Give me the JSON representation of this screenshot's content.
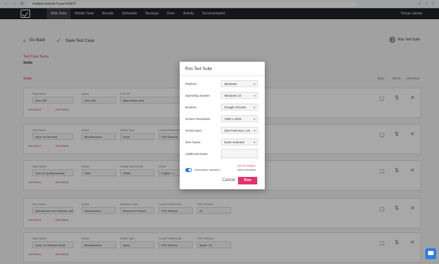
{
  "browser": {
    "url": "endtest.io/tests?case=63637",
    "nav_icons": [
      "back-arrow",
      "forward-arrow",
      "reload"
    ]
  },
  "appbar": {
    "nav": [
      "Web Tests",
      "Mobile Tests",
      "Results",
      "Scheduler",
      "Backups",
      "Drive",
      "Activity",
      "Documentation"
    ],
    "user": "Tomas Jakobs"
  },
  "page": {
    "back_label": "Go Back",
    "save_label": "Save Test Case",
    "run_suite_label": "Run Test Suite",
    "test_case_name_label": "Test Case Name",
    "test_case_name": "Selim",
    "steps_label": "Steps",
    "col_headers": [
      "Skip",
      "Move",
      "Remove"
    ],
    "steps": [
      {
        "label1": "Step Name",
        "v1": "Goto URL",
        "label2": "Action",
        "v2": "Goto URL",
        "label3": "Full URL",
        "v3": "https://selim.com/",
        "add_after": "Add Above",
        "add_below": "Add Below"
      },
      {
        "label1": "Step Name",
        "v1": "Hover on Services",
        "label2": "Action",
        "v2": "Miscellaneous",
        "label3": "Action Type",
        "v3": "Hover",
        "label4": "Locate Element By",
        "v4": "CSS Selector",
        "add_after": "Add Above",
        "add_below": "Add Below"
      },
      {
        "label1": "Step Name",
        "v1": "Click on Quality Assuran",
        "label2": "Action",
        "v2": "Click",
        "label3": "Locate Element By",
        "v3": "XPath",
        "label4": "XPath",
        "v4": "//*[@id=...]",
        "add_after": "Add Above",
        "add_below": "Add Below"
      },
      {
        "label1": "Step Name",
        "v1": "Add Assertion for Software Quali",
        "label2": "Action",
        "v2": "Add Assertion",
        "label3": "Assertion Type",
        "v3": "Element Is Present",
        "label4": "Locate Element By",
        "v4": "CSS Selector",
        "label5": "CSS Selector",
        "v5": "h1",
        "add_after": "Add Above",
        "add_below": "Add Below"
      },
      {
        "label1": "Step Name",
        "v1": "Hover on Software Quali",
        "label2": "Action",
        "v2": "Miscellaneous",
        "label3": "Action Type",
        "v3": "Hover",
        "label4": "Locate Element By",
        "v4": "CSS Selector",
        "label5": "CSS Selector",
        "v5": "#path > rb",
        "add_after": "Add Above",
        "add_below": "Add Below"
      }
    ]
  },
  "modal": {
    "title": "Run Test Suite",
    "fields": [
      {
        "label": "Platform",
        "value": "Windows"
      },
      {
        "label": "Operating System",
        "value": "Windows 10"
      },
      {
        "label": "Browser",
        "value": "Google Chrome"
      },
      {
        "label": "Screen Resolution",
        "value": "1280 x 1024"
      },
      {
        "label": "Geolocation",
        "value": "San Francisco, US"
      },
      {
        "label": "Test Cases",
        "value": "None selected"
      }
    ],
    "notes_label": "Additional Notes",
    "remember_label": "Remember selection",
    "get_api_label": "Get API Request",
    "add_scheduler_label": "Add to Scheduler",
    "cancel_label": "Cancel",
    "run_label": "Run"
  },
  "colors": {
    "accent": "#e7306f",
    "toggle": "#2b7de9",
    "appbar": "#1f2228"
  }
}
